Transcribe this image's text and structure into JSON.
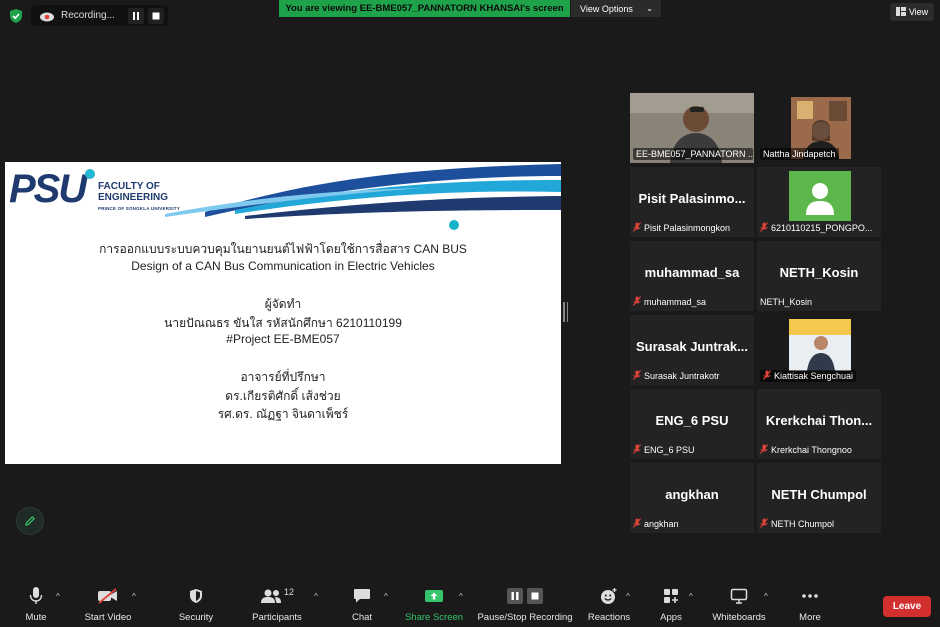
{
  "top_bar": {
    "recording_label": "Recording...",
    "banner_text": "You are viewing EE-BME057_PANNATORN KHANSAI's screen",
    "view_options_label": "View Options",
    "view_label": "View",
    "colors": {
      "banner": "#1fa34a",
      "shield": "#1fa34a"
    }
  },
  "slide": {
    "logo_text": "PSU",
    "faculty_line1": "FACULTY OF",
    "faculty_line2": "ENGINEERING",
    "faculty_sub": "PRINCE OF SONGKLA UNIVERSITY",
    "title_th": "การออกแบบระบบควบคุมในยานยนต์ไฟฟ้าโดยใช้การสื่อสาร CAN BUS",
    "title_en": "Design of a CAN Bus Communication in Electric Vehicles",
    "author_label": "ผู้จัดทำ",
    "author_name": "นายปัณณธร ขันใส รหัสนักศึกษา 6210110199",
    "project_id": "#Project EE-BME057",
    "advisor_label": "อาจารย์ที่ปรึกษา",
    "advisor_1": "ดร.เกียรติศักดิ์ เส้งช่วย",
    "advisor_2": "รศ.ดร. ณัฏฐา จินดาเพ็ชร์"
  },
  "gallery": [
    {
      "big": "",
      "caption": "EE-BME057_PANNATORN ...",
      "muted": false,
      "video": true,
      "active": false
    },
    {
      "big": "",
      "caption": "Nattha Jindapetch",
      "muted": false,
      "video": true,
      "active": true
    },
    {
      "big": "Pisit Palasinmo...",
      "caption": "Pisit Palasinmongkon",
      "muted": true,
      "video": false,
      "active": false
    },
    {
      "big": "",
      "caption": "6210110215_PONGPO...",
      "muted": true,
      "video": false,
      "avatar": true,
      "active": false
    },
    {
      "big": "muhammad_sa",
      "caption": "muhammad_sa",
      "muted": true,
      "video": false,
      "active": false
    },
    {
      "big": "NETH_Kosin",
      "caption": "NETH_Kosin",
      "muted": false,
      "video": false,
      "active": false
    },
    {
      "big": "Surasak Juntrak...",
      "caption": "Surasak Juntrakotr",
      "muted": true,
      "video": false,
      "active": false
    },
    {
      "big": "",
      "caption": "Kiattisak Sengchuai",
      "muted": true,
      "video": true,
      "active": false
    },
    {
      "big": "ENG_6 PSU",
      "caption": "ENG_6 PSU",
      "muted": true,
      "video": false,
      "active": false
    },
    {
      "big": "Krerkchai Thon...",
      "caption": "Krerkchai Thongnoo",
      "muted": true,
      "video": false,
      "active": false
    },
    {
      "big": "angkhan",
      "caption": "angkhan",
      "muted": true,
      "video": false,
      "active": false
    },
    {
      "big": "NETH Chumpol",
      "caption": "NETH Chumpol",
      "muted": true,
      "video": false,
      "active": false
    }
  ],
  "toolbar": {
    "mute": "Mute",
    "start_video": "Start Video",
    "security": "Security",
    "participants": "Participants",
    "participants_count": "12",
    "chat": "Chat",
    "share_screen": "Share Screen",
    "pause_stop_recording": "Pause/Stop Recording",
    "reactions": "Reactions",
    "apps": "Apps",
    "whiteboards": "Whiteboards",
    "more": "More",
    "leave": "Leave"
  }
}
